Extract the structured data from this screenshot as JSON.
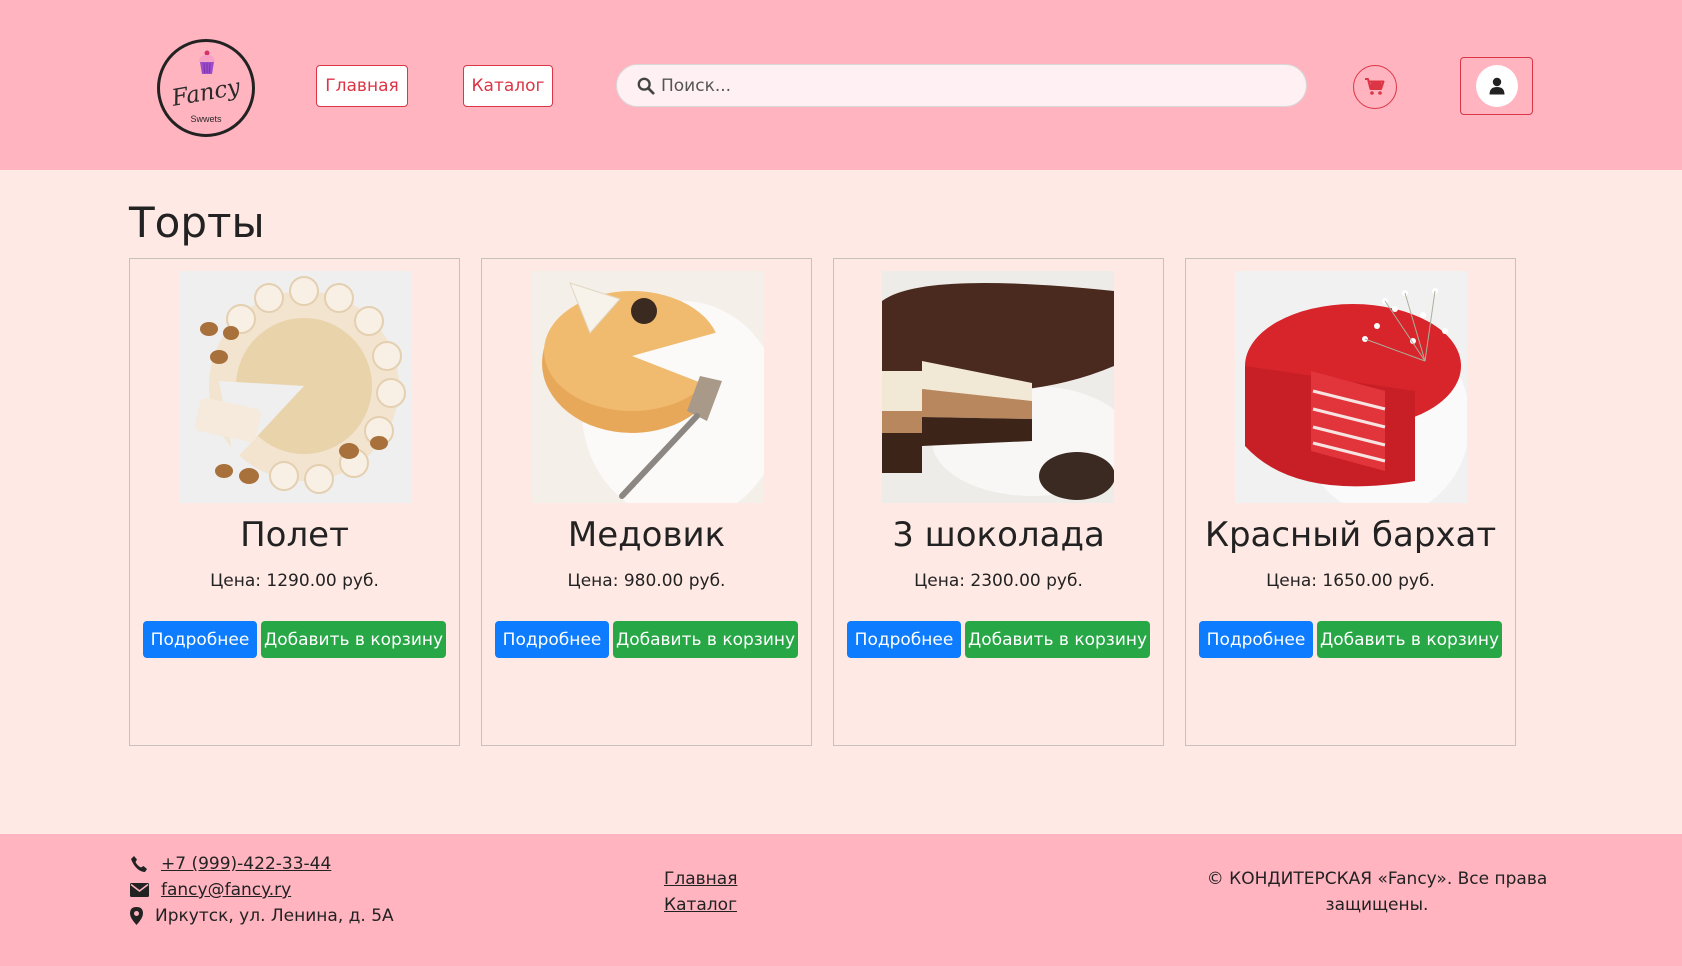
{
  "header": {
    "logo": {
      "brand": "Fancy",
      "tagline": "Swwets"
    },
    "nav": {
      "home": "Главная",
      "catalog": "Каталог"
    },
    "search": {
      "placeholder": "Поиск..."
    }
  },
  "page": {
    "title": "Торты"
  },
  "products": [
    {
      "name": "Полет",
      "price": "Цена: 1290.00 руб.",
      "more_label": "Подробнее",
      "add_label": "Добавить в корзину"
    },
    {
      "name": "Медовик",
      "price": "Цена: 980.00 руб.",
      "more_label": "Подробнее",
      "add_label": "Добавить в корзину"
    },
    {
      "name": "3 шоколада",
      "price": "Цена: 2300.00 руб.",
      "more_label": "Подробнее",
      "add_label": "Добавить в корзину"
    },
    {
      "name": "Красный бархат",
      "price": "Цена: 1650.00 руб.",
      "more_label": "Подробнее",
      "add_label": "Добавить в корзину"
    }
  ],
  "footer": {
    "phone": "+7 (999)-422-33-44",
    "email": "fancy@fancy.ry",
    "address": "Иркутск, ул. Ленина, д. 5А",
    "links": {
      "home": "Главная",
      "catalog": "Каталог"
    },
    "copyright": "© КОНДИТЕРСКАЯ «Fancy». Все права защищены."
  },
  "colors": {
    "header_bg": "#ffb4c0",
    "page_bg": "#ffe9e4",
    "accent_red": "#dc3545",
    "btn_primary": "#0d7cff",
    "btn_success": "#27a745"
  },
  "icons": [
    "search-icon",
    "cart-icon",
    "user-icon",
    "phone-icon",
    "envelope-icon",
    "map-marker-icon"
  ]
}
